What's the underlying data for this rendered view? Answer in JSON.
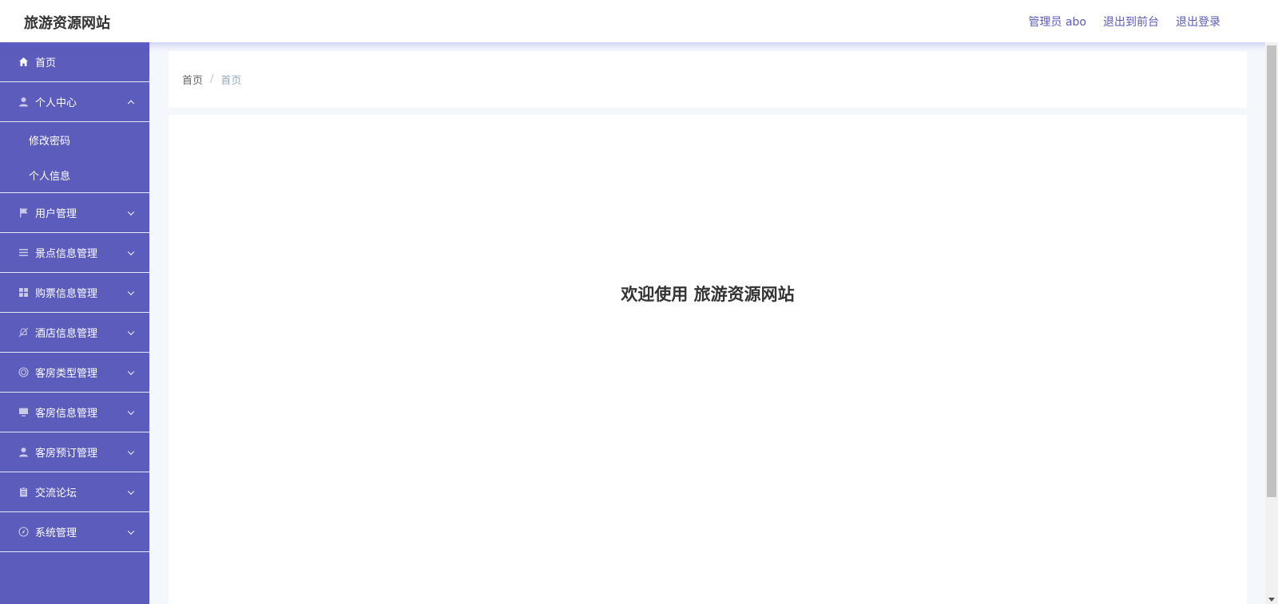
{
  "header": {
    "site_title": "旅游资源网站",
    "links": [
      "管理员 abo",
      "退出到前台",
      "退出登录"
    ]
  },
  "sidebar": {
    "items": [
      {
        "label": "首页",
        "icon": "home-icon"
      },
      {
        "label": "个人中心",
        "icon": "user-icon",
        "expanded": true,
        "children": [
          "修改密码",
          "个人信息"
        ]
      },
      {
        "label": "用户管理",
        "icon": "flag-icon"
      },
      {
        "label": "景点信息管理",
        "icon": "list-icon"
      },
      {
        "label": "购票信息管理",
        "icon": "grid-icon"
      },
      {
        "label": "酒店信息管理",
        "icon": "bell-off-icon"
      },
      {
        "label": "客房类型管理",
        "icon": "circle-icon"
      },
      {
        "label": "客房信息管理",
        "icon": "monitor-icon"
      },
      {
        "label": "客房预订管理",
        "icon": "user-icon"
      },
      {
        "label": "交流论坛",
        "icon": "clipboard-icon"
      },
      {
        "label": "系统管理",
        "icon": "compass-icon"
      }
    ]
  },
  "breadcrumb": {
    "home": "首页",
    "separator": "/",
    "current": "首页"
  },
  "main": {
    "welcome": "欢迎使用 旅游资源网站"
  },
  "colors": {
    "sidebar": "#5b5cbc",
    "link": "#5b5bb8"
  }
}
